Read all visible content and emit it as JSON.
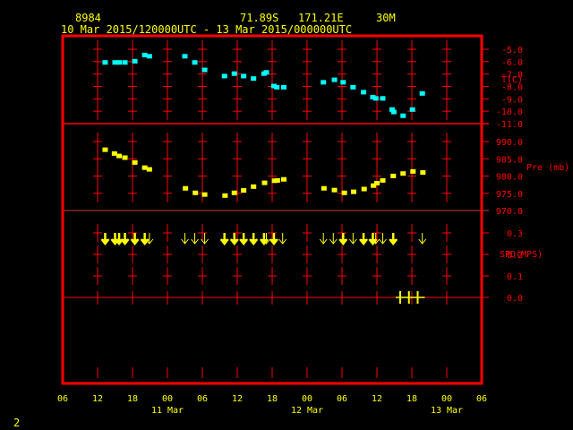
{
  "header": {
    "station": "8984",
    "lat": "71.89S",
    "lon": "171.21E",
    "height": "30M",
    "period": "10 Mar 2015/120000UTC - 13 Mar 2015/000000UTC"
  },
  "footer": {
    "page": "2"
  },
  "colors": {
    "frame": "#ff0000",
    "temp": "#00ffff",
    "pressure": "#ffff00",
    "wind": "#ffff00",
    "text": "#ffff00"
  },
  "chart_data": [
    {
      "type": "scatter",
      "name": "temperature",
      "ylabel": "T(C)",
      "ylim": [
        -11.0,
        -5.0
      ],
      "yticks": [
        "-5.0",
        "-6.0",
        "-7.0",
        "-8.0",
        "-9.0",
        "-10.0",
        "-11.0"
      ],
      "x_hours_since_10Mar06": [
        7.3,
        9.0,
        9.7,
        10.7,
        12.4,
        14.1,
        14.9,
        21.0,
        22.7,
        24.4,
        27.8,
        29.5,
        31.1,
        32.8,
        34.6,
        35.0,
        36.3,
        36.8,
        38.0,
        44.8,
        46.7,
        48.2,
        49.9,
        51.7,
        53.3,
        53.8,
        55.0,
        56.6,
        56.9,
        58.5,
        60.1,
        61.8
      ],
      "values": [
        -6.1,
        -6.1,
        -6.1,
        -6.1,
        -6.0,
        -5.5,
        -5.6,
        -5.6,
        -6.1,
        -6.7,
        -7.2,
        -7.0,
        -7.2,
        -7.4,
        -7.0,
        -6.9,
        -8.0,
        -8.1,
        -8.1,
        -7.7,
        -7.5,
        -7.7,
        -8.1,
        -8.5,
        -8.9,
        -9.0,
        -9.0,
        -9.9,
        -10.1,
        -10.4,
        -9.9,
        -8.6
      ]
    },
    {
      "type": "scatter",
      "name": "pressure",
      "ylabel": "Pre (mb)",
      "ylim": [
        970.0,
        990.0
      ],
      "yticks": [
        "990.0",
        "985.0",
        "980.0",
        "975.0",
        "970.0"
      ],
      "x_hours_since_10Mar06": [
        7.3,
        8.9,
        9.7,
        10.7,
        12.4,
        14.1,
        14.9,
        21.1,
        22.8,
        24.4,
        27.9,
        29.5,
        31.1,
        32.8,
        34.7,
        36.4,
        36.9,
        38.0,
        44.9,
        46.7,
        48.4,
        50.0,
        51.8,
        53.4,
        54.0,
        55.0,
        56.8,
        58.5,
        60.2,
        61.9
      ],
      "values": [
        987.5,
        986.4,
        985.7,
        985.2,
        983.8,
        982.3,
        981.8,
        976.3,
        975.0,
        974.5,
        974.2,
        975.0,
        975.7,
        976.8,
        977.9,
        978.5,
        978.6,
        978.9,
        976.3,
        975.8,
        975.0,
        975.3,
        976.1,
        977.1,
        977.8,
        978.6,
        979.9,
        980.6,
        981.2,
        980.9
      ]
    },
    {
      "type": "wind",
      "name": "wind speed",
      "ylabel": "SPD(MPS)",
      "ylim": [
        0.0,
        0.3
      ],
      "yticks": [
        "0.3",
        "0.2",
        "0.1",
        "0.0"
      ],
      "x_hours_since_10Mar06": [
        7.3,
        9.0,
        9.7,
        10.7,
        12.4,
        14.1,
        14.9,
        21.0,
        22.7,
        24.4,
        27.8,
        29.5,
        31.1,
        32.8,
        34.6,
        35.0,
        36.3,
        37.8,
        44.8,
        46.5,
        48.2,
        49.9,
        51.7,
        53.3,
        53.8,
        55.0,
        56.8,
        61.8
      ],
      "values": [
        0.3,
        0.3,
        0.3,
        0.3,
        0.3,
        0.3,
        0.3,
        0.3,
        0.3,
        0.3,
        0.3,
        0.3,
        0.3,
        0.3,
        0.3,
        0.3,
        0.3,
        0.3,
        0.3,
        0.3,
        0.3,
        0.3,
        0.3,
        0.3,
        0.3,
        0.3,
        0.3,
        0.3
      ],
      "bold": [
        1,
        1,
        1,
        1,
        1,
        1,
        0,
        0,
        0,
        0,
        1,
        1,
        1,
        1,
        1,
        0,
        1,
        0,
        0,
        0,
        1,
        0,
        1,
        1,
        0,
        0,
        1,
        0
      ],
      "calm_hours": [
        58.0,
        59.5,
        61.0
      ]
    }
  ],
  "xaxis": {
    "range_hours": [
      0,
      72
    ],
    "ticks": [
      "06",
      "12",
      "18",
      "00",
      "06",
      "12",
      "18",
      "00",
      "06",
      "12",
      "18",
      "00",
      "06"
    ],
    "dates": [
      {
        "label": "11 Mar",
        "tick": 3
      },
      {
        "label": "12 Mar",
        "tick": 7
      },
      {
        "label": "13 Mar",
        "tick": 11
      }
    ]
  }
}
